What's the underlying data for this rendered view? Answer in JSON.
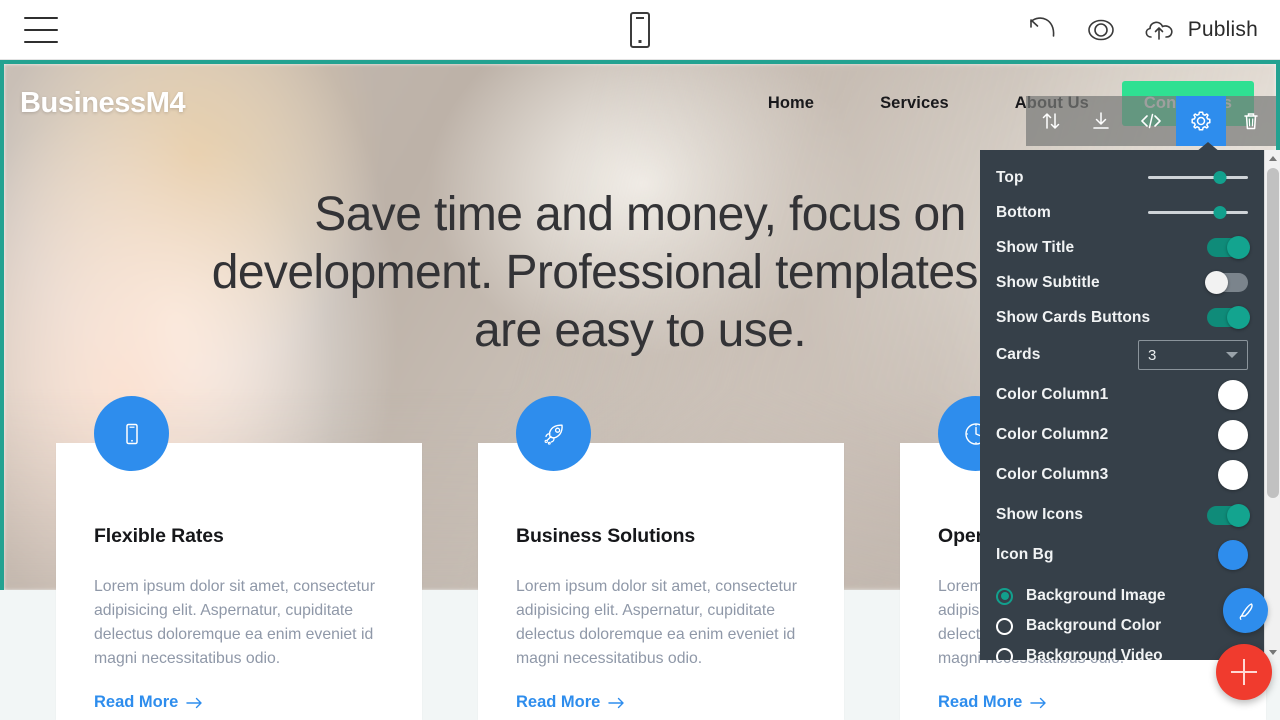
{
  "editor": {
    "topbar": {
      "menu_icon": "hamburger-menu-icon",
      "device_icon": "mobile-preview-icon",
      "undo_icon": "undo-icon",
      "preview_icon": "eye-preview-icon",
      "publish_icon": "cloud-upload-icon",
      "publish_label": "Publish"
    },
    "block_toolbar": {
      "items": [
        {
          "name": "move-block",
          "icon": "up-down-arrows-icon",
          "active": false
        },
        {
          "name": "download-block",
          "icon": "download-icon",
          "active": false
        },
        {
          "name": "edit-code",
          "icon": "code-brackets-icon",
          "active": false
        },
        {
          "name": "block-settings",
          "icon": "gear-icon",
          "active": true
        },
        {
          "name": "delete-block",
          "icon": "trash-icon",
          "active": false
        }
      ],
      "active_color": "#2e8ded"
    },
    "fabs": {
      "pen_icon": "pen-brush-icon",
      "pen_color": "#2e8ded",
      "add_icon": "plus-icon",
      "add_color": "#f03b2e"
    }
  },
  "settings_panel": {
    "bg_color": "#364049",
    "accent_color": "#12a08d",
    "sliders": [
      {
        "label": "Top",
        "value": 72
      },
      {
        "label": "Bottom",
        "value": 72
      }
    ],
    "toggles": [
      {
        "label": "Show Title",
        "state": "on"
      },
      {
        "label": "Show Subtitle",
        "state": "off"
      },
      {
        "label": "Show Cards Buttons",
        "state": "on"
      }
    ],
    "cards_select": {
      "label": "Cards",
      "value": "3"
    },
    "color_rows": [
      {
        "label": "Color Column1",
        "color": "#ffffff"
      },
      {
        "label": "Color Column2",
        "color": "#ffffff"
      },
      {
        "label": "Color Column3",
        "color": "#ffffff"
      }
    ],
    "show_icons": {
      "label": "Show Icons",
      "state": "on"
    },
    "icon_bg": {
      "label": "Icon Bg",
      "color": "#2e8ded"
    },
    "background_options": [
      {
        "label": "Background Image",
        "selected": true
      },
      {
        "label": "Background Color",
        "selected": false
      },
      {
        "label": "Background Video",
        "selected": false
      }
    ]
  },
  "page": {
    "section_border_color": "#23a291",
    "nav": {
      "brand": "BusinessM4",
      "links": [
        "Home",
        "Services",
        "About Us"
      ],
      "cta_label": "Contact Us",
      "cta_color": "#2fe092"
    },
    "hero": {
      "title": "Save time and money, focus on development. Professional templates that are easy to use."
    },
    "cards": [
      {
        "icon": "mobile-phone-icon",
        "icon_bg": "#2e8ded",
        "title": "Flexible Rates",
        "text": "Lorem ipsum dolor sit amet, consectetur adipisicing elit. Aspernatur, cupiditate delectus doloremque ea enim eveniet id magni necessitatibus odio.",
        "link_label": "Read More"
      },
      {
        "icon": "rocket-icon",
        "icon_bg": "#2e8ded",
        "title": "Business Solutions",
        "text": "Lorem ipsum dolor sit amet, consectetur adipisicing elit. Aspernatur, cupiditate delectus doloremque ea enim eveniet id magni necessitatibus odio.",
        "link_label": "Read More"
      },
      {
        "icon": "clock-icon",
        "icon_bg": "#2e8ded",
        "title": "Opening Hours",
        "text": "Lorem ipsum dolor sit amet, consectetur adipisicing elit. Aspernatur, cupiditate delectus doloremque ea enim eveniet id magni necessitatibus odio.",
        "link_label": "Read More"
      }
    ]
  }
}
